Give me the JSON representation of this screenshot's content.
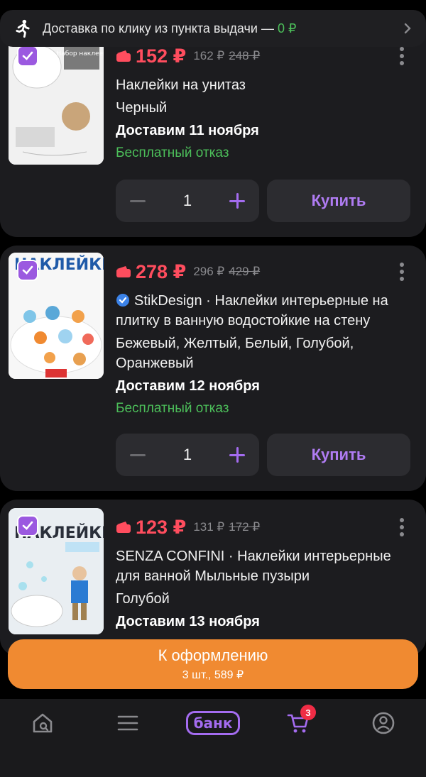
{
  "banner": {
    "text": "Доставка по клику из пункта выдачи — ",
    "price": "0 ₽",
    "icon": "runner-icon"
  },
  "items": [
    {
      "image_text": "Набор наклеек",
      "price": "152 ₽",
      "old_price": "162 ₽",
      "crossed_price": "248 ₽",
      "title": "Наклейки на унитаз",
      "color": "Черный",
      "delivery": "Доставим 11 ноября",
      "refusal": "Бесплатный отказ",
      "quantity": "1",
      "buy_label": "Купить"
    },
    {
      "image_text": "НАКЛЕЙКИ",
      "price": "278 ₽",
      "old_price": "296 ₽",
      "crossed_price": "429 ₽",
      "seller": "StikDesign",
      "title": "StikDesign · Наклейки интерьерные на плитку в ванную водостойкие на стену",
      "color": "Бежевый, Желтый, Белый, Голубой, Оранжевый",
      "delivery": "Доставим 12 ноября",
      "refusal": "Бесплатный отказ",
      "quantity": "1",
      "buy_label": "Купить"
    },
    {
      "image_text": "НАКЛЕЙКИ",
      "price": "123 ₽",
      "old_price": "131 ₽",
      "crossed_price": "172 ₽",
      "title": "SENZA CONFINI · Наклейки интерьерные для ванной Мыльные пузыри",
      "color": "Голубой",
      "delivery": "Доставим 13 ноября"
    }
  ],
  "checkout": {
    "label": "К оформлению",
    "summary": "3 шт., 589 ₽"
  },
  "bottom_nav": {
    "bank_label": "банк",
    "cart_count": "3"
  },
  "colors": {
    "accent": "#a46cf0",
    "price": "#ff4d5e",
    "success": "#4cbf5a",
    "checkout": "#f08a31"
  }
}
